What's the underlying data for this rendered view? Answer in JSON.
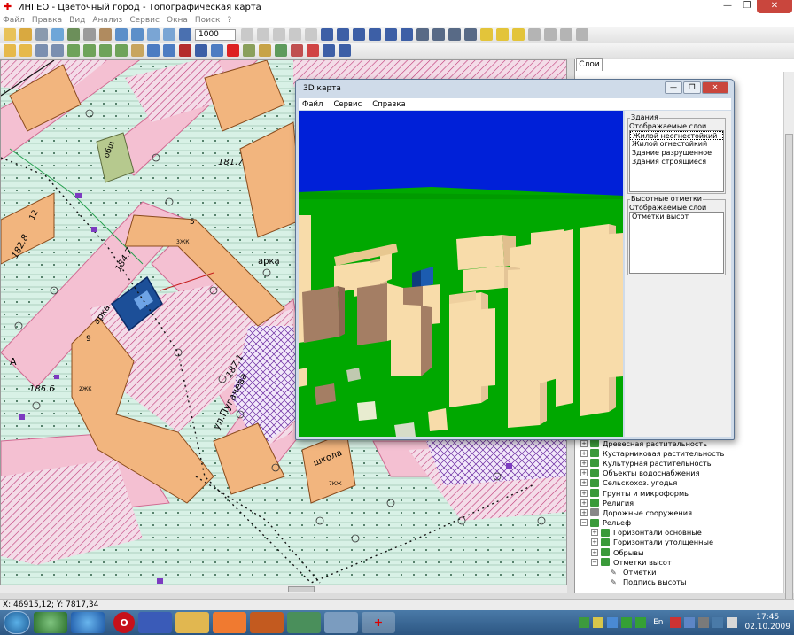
{
  "app": {
    "title": "ИНГЕО - Цветочный город - Топографическая карта",
    "menu": [
      "Файл",
      "Правка",
      "Вид",
      "Анализ",
      "Сервис",
      "Окна",
      "Поиск",
      "?"
    ],
    "zoom": "1000"
  },
  "map": {
    "labels": {
      "n12": "12",
      "n5": "5",
      "n9": "9",
      "obsh": "общ",
      "arka1": "арка",
      "arka2": "арка",
      "street": "ул.Пугачева",
      "school": "школа",
      "elev1": "182.8",
      "elev2": "185.6",
      "elev3": "184.7",
      "elev4": "187.1",
      "elev5": "181.7",
      "road": "А",
      "zh3": "3ЖК",
      "zh2": "2ЖК",
      "zh7": "7КЖ"
    }
  },
  "panel": {
    "tab": "Слои",
    "tree": [
      {
        "level": 1,
        "label": "Древесная растительность",
        "exp": "+"
      },
      {
        "level": 1,
        "label": "Кустарниковая растительность",
        "exp": "+"
      },
      {
        "level": 1,
        "label": "Культурная растительность",
        "exp": "+"
      },
      {
        "level": 1,
        "label": "Объекты водоснабжения",
        "exp": "+"
      },
      {
        "level": 1,
        "label": "Сельскохоз. угодья",
        "exp": "+"
      },
      {
        "level": 1,
        "label": "Грунты и микроформы",
        "exp": "+"
      },
      {
        "level": 1,
        "label": "Религия",
        "exp": "+"
      },
      {
        "level": 1,
        "label": "Дорожные сооружения",
        "exp": "+"
      },
      {
        "level": 1,
        "label": "Рельеф",
        "exp": "−"
      },
      {
        "level": 2,
        "label": "Горизонтали основные",
        "exp": "+"
      },
      {
        "level": 2,
        "label": "Горизонтали утолщенные",
        "exp": "+"
      },
      {
        "level": 2,
        "label": "Обрывы",
        "exp": "+"
      },
      {
        "level": 2,
        "label": "Отметки высот",
        "exp": "−"
      },
      {
        "level": 3,
        "label": "Отметки",
        "exp": ""
      },
      {
        "level": 3,
        "label": "Подпись высоты",
        "exp": ""
      }
    ]
  },
  "status": {
    "coords": "X: 46915,12; Y: 7817,34"
  },
  "taskbar": {
    "lang": "En",
    "time": "17:45",
    "date": "02.10.2009"
  },
  "win3d": {
    "title": "3D карта",
    "menu": [
      "Файл",
      "Сервис",
      "Справка"
    ],
    "group1": {
      "legend": "Здания",
      "sub": "Отображаемые слои",
      "items": [
        "Жилой неогнестойкий",
        "Жилой огнестойкий",
        "Здание разрушенное",
        "Здания строящиеся"
      ]
    },
    "group2": {
      "legend": "Высотные отметки",
      "sub": "Отображаемые слои",
      "items": [
        "Отметки высот"
      ]
    }
  },
  "colors": {
    "sky": "#0020d8",
    "ground": "#00a800",
    "building": "#f8dcaa",
    "building_shadow": "#a47e64",
    "selected_building": "#1c5cb0"
  }
}
